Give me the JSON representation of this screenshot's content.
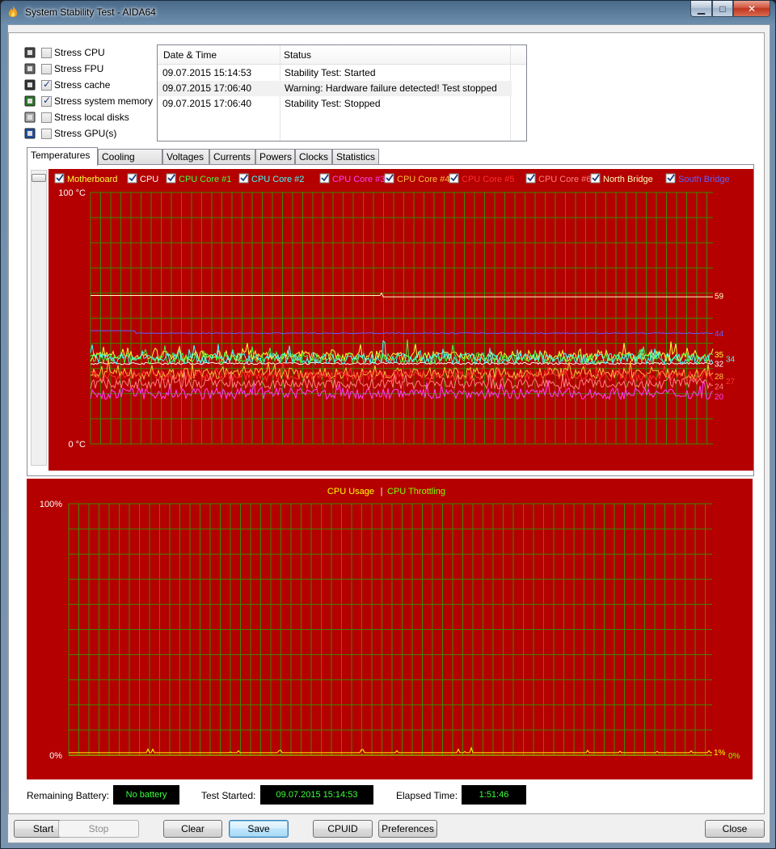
{
  "window": {
    "title": "System Stability Test - AIDA64",
    "minimize_glyph": "▁",
    "maximize_glyph": "□",
    "close_glyph": "✕"
  },
  "stress_options": [
    {
      "label": "Stress CPU",
      "checked": false,
      "icon": "cpu-icon"
    },
    {
      "label": "Stress FPU",
      "checked": false,
      "icon": "fpu-icon"
    },
    {
      "label": "Stress cache",
      "checked": true,
      "icon": "cache-icon"
    },
    {
      "label": "Stress system memory",
      "checked": true,
      "icon": "memory-icon"
    },
    {
      "label": "Stress local disks",
      "checked": false,
      "icon": "disk-icon"
    },
    {
      "label": "Stress GPU(s)",
      "checked": false,
      "icon": "gpu-icon"
    }
  ],
  "log": {
    "headers": [
      "Date & Time",
      "Status"
    ],
    "rows": [
      {
        "datetime": "09.07.2015 15:14:53",
        "status": "Stability Test: Started"
      },
      {
        "datetime": "09.07.2015 17:06:40",
        "status": "Warning: Hardware failure detected! Test stopped"
      },
      {
        "datetime": "09.07.2015 17:06:40",
        "status": "Stability Test: Stopped"
      }
    ]
  },
  "tabs": [
    "Temperatures",
    "Cooling Fans",
    "Voltages",
    "Currents",
    "Powers",
    "Clocks",
    "Statistics"
  ],
  "active_tab": "Temperatures",
  "colors": {
    "graph_bg": "#b40000",
    "grid": "#3a8a00",
    "accent_lcd": "#3cff3c"
  },
  "chart_data": [
    {
      "type": "line",
      "ylim": [
        0,
        100
      ],
      "ymax_label": "100 °C",
      "ymin_label": "0 °C",
      "grid": true,
      "legend_placement": "top",
      "series": [
        {
          "name": "Motherboard",
          "color": "#ffff40",
          "last_value": 35,
          "label": "35"
        },
        {
          "name": "CPU",
          "color": "#ffffff",
          "last_value": 32,
          "label": "32"
        },
        {
          "name": "CPU Core #1",
          "color": "#40ff40",
          "last_value": 34,
          "label": "34"
        },
        {
          "name": "CPU Core #2",
          "color": "#40ffff",
          "last_value": 34,
          "label": "34"
        },
        {
          "name": "CPU Core #3",
          "color": "#ff40ff",
          "last_value": 20,
          "label": "20"
        },
        {
          "name": "CPU Core #4",
          "color": "#ffc040",
          "last_value": 28,
          "label": "28"
        },
        {
          "name": "CPU Core #5",
          "color": "#ff3030",
          "last_value": 27,
          "label": "27"
        },
        {
          "name": "CPU Core #6",
          "color": "#ff8080",
          "last_value": 24,
          "label": "24"
        },
        {
          "name": "North Bridge",
          "color": "#ffffc0",
          "last_value": 59,
          "label": "59"
        },
        {
          "name": "South Bridge",
          "color": "#6060ff",
          "last_value": 44,
          "label": "44"
        }
      ]
    },
    {
      "type": "line",
      "ylim": [
        0,
        100
      ],
      "ymax_label": "100%",
      "ymin_label": "0%",
      "grid": true,
      "legend_placement": "top",
      "separator": "|",
      "series": [
        {
          "name": "CPU Usage",
          "color": "#ffff00",
          "last_value": 1,
          "label": "1%"
        },
        {
          "name": "CPU Throttling",
          "color": "#80ff00",
          "last_value": 0,
          "label": "0%"
        }
      ]
    }
  ],
  "status": {
    "battery_label": "Remaining Battery:",
    "battery_value": "No battery",
    "started_label": "Test Started:",
    "started_value": "09.07.2015 15:14:53",
    "elapsed_label": "Elapsed Time:",
    "elapsed_value": "1:51:46"
  },
  "buttons": {
    "start": "Start",
    "stop": "Stop",
    "clear": "Clear",
    "save": "Save",
    "cpuid": "CPUID",
    "preferences": "Preferences",
    "close": "Close"
  }
}
